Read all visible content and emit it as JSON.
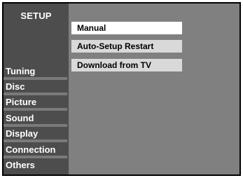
{
  "setup": {
    "title": "SETUP",
    "categories": [
      {
        "label": "Tuning"
      },
      {
        "label": "Disc"
      },
      {
        "label": "Picture"
      },
      {
        "label": "Sound"
      },
      {
        "label": "Display"
      },
      {
        "label": "Connection"
      },
      {
        "label": "Others"
      }
    ],
    "active_category": "Tuning",
    "options": [
      {
        "label": "Manual",
        "selected": true
      },
      {
        "label": "Auto-Setup Restart",
        "selected": false
      },
      {
        "label": "Download from TV",
        "selected": false
      }
    ]
  }
}
